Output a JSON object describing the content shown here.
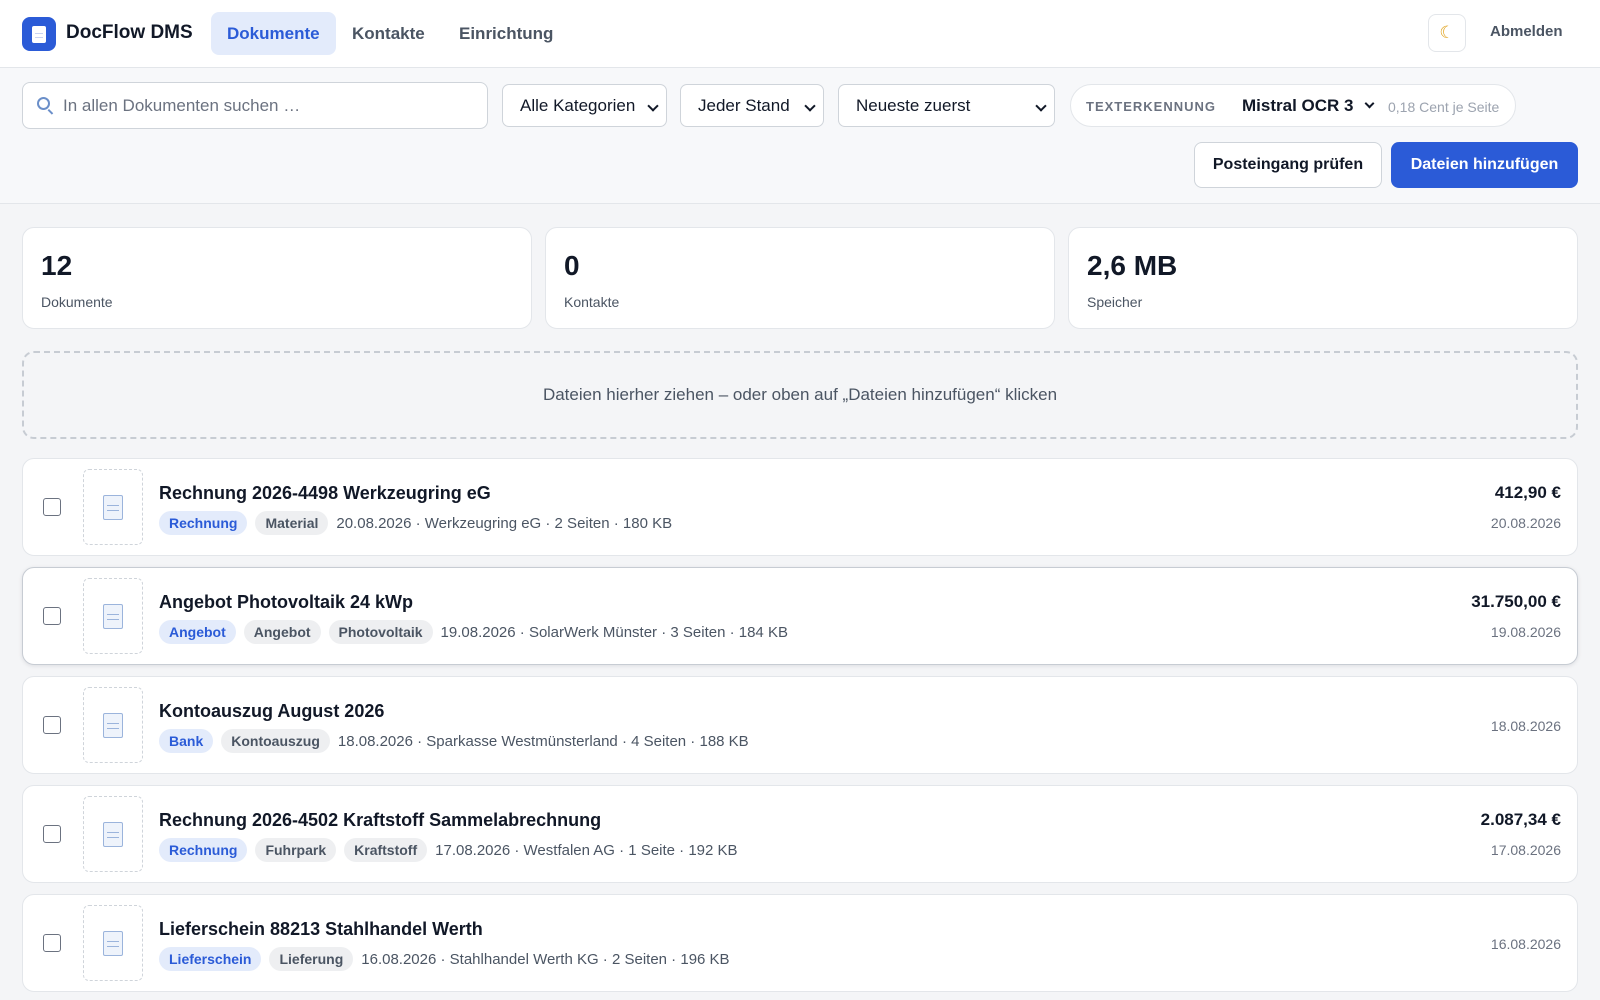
{
  "app": {
    "name": "DocFlow DMS",
    "logo_icon": "document-icon"
  },
  "nav": {
    "tabs": [
      {
        "label": "Dokumente",
        "active": true
      },
      {
        "label": "Kontakte",
        "active": false
      },
      {
        "label": "Einrichtung",
        "active": false
      }
    ],
    "theme_icon": "moon-icon",
    "logout_label": "Abmelden"
  },
  "filters": {
    "search_placeholder": "In allen Dokumenten suchen …",
    "category": "Alle Kategorien",
    "status": "Jeder Stand",
    "sort": "Neueste zuerst",
    "ocr": {
      "label": "TEXTERKENNUNG",
      "model": "Mistral OCR 3",
      "price": "0,18 Cent je Seite"
    }
  },
  "actions": {
    "check_inbox": "Posteingang prüfen",
    "add_files": "Dateien hinzufügen"
  },
  "stats": [
    {
      "value": "12",
      "label": "Dokumente"
    },
    {
      "value": "0",
      "label": "Kontakte"
    },
    {
      "value": "2,6 MB",
      "label": "Speicher"
    }
  ],
  "dropzone": {
    "text": "Dateien hierher ziehen – oder oben auf „Dateien hinzufügen“ klicken"
  },
  "documents": [
    {
      "title": "Rechnung 2026-4498 Werkzeugring eG",
      "tags": [
        "Rechnung",
        "Material"
      ],
      "meta": "20.08.2026 · Werkzeugring eG · 2 Seiten · 180 KB",
      "amount": "412,90 €",
      "date": "20.08.2026"
    },
    {
      "title": "Angebot Photovoltaik 24 kWp",
      "tags": [
        "Angebot",
        "Angebot",
        "Photovoltaik"
      ],
      "meta": "19.08.2026 · SolarWerk Münster · 3 Seiten · 184 KB",
      "amount": "31.750,00 €",
      "date": "19.08.2026"
    },
    {
      "title": "Kontoauszug August 2026",
      "tags": [
        "Bank",
        "Kontoauszug"
      ],
      "meta": "18.08.2026 · Sparkasse Westmünsterland · 4 Seiten · 188 KB",
      "amount": "",
      "date": "18.08.2026"
    },
    {
      "title": "Rechnung 2026-4502 Kraftstoff Sammelabrechnung",
      "tags": [
        "Rechnung",
        "Fuhrpark",
        "Kraftstoff"
      ],
      "meta": "17.08.2026 · Westfalen AG · 1 Seite · 192 KB",
      "amount": "2.087,34 €",
      "date": "17.08.2026"
    },
    {
      "title": "Lieferschein 88213 Stahlhandel Werth",
      "tags": [
        "Lieferschein",
        "Lieferung"
      ],
      "meta": "16.08.2026 · Stahlhandel Werth KG · 2 Seiten · 196 KB",
      "amount": "",
      "date": "16.08.2026"
    }
  ],
  "colors": {
    "accent": "#2b5bd7",
    "accent_soft": "#e3ebfb",
    "border": "#e3e6ea",
    "background": "#f4f5f7"
  }
}
